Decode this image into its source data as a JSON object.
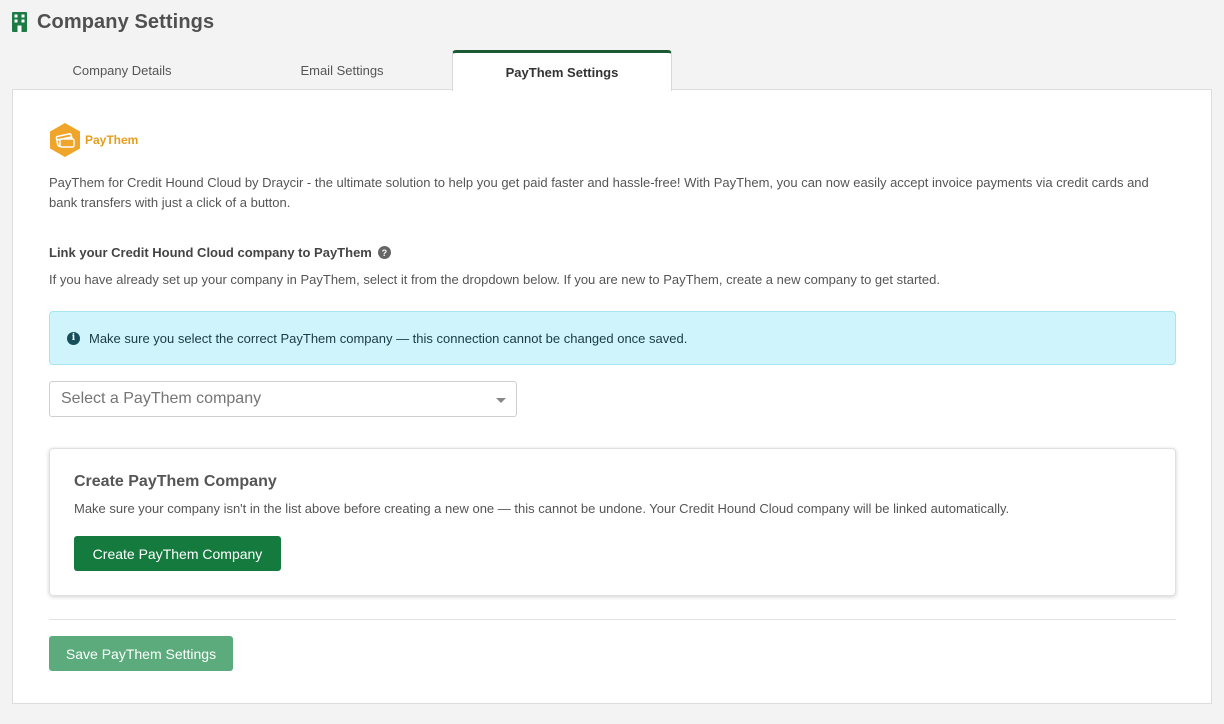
{
  "header": {
    "icon": "building-icon",
    "title": "Company Settings",
    "accent_color": "#1c5a34"
  },
  "tabs": [
    {
      "label": "Company Details",
      "active": false
    },
    {
      "label": "Email Settings",
      "active": false
    },
    {
      "label": "PayThem Settings",
      "active": true
    }
  ],
  "paythem": {
    "logo_text": "PayThem",
    "logo_color": "#e69e1f",
    "intro": "PayThem for Credit Hound Cloud by Draycir - the ultimate solution to help you get paid faster and hassle-free! With PayThem, you can now easily accept invoice payments via credit cards and bank transfers with just a click of a button.",
    "link_heading": "Link your Credit Hound Cloud company to PayThem",
    "help_icon_glyph": "?",
    "link_description": "If you have already set up your company in PayThem, select it from the dropdown below. If you are new to PayThem, create a new company to get started.",
    "alert": {
      "icon_glyph": "i",
      "text": "Make sure you select the correct PayThem company — this connection cannot be changed once saved.",
      "background": "#cff4fc"
    },
    "select": {
      "placeholder": "Select a PayThem company",
      "value": ""
    },
    "create_card": {
      "title": "Create PayThem Company",
      "description": "Make sure your company isn't in the list above before creating a new one — this cannot be undone. Your Credit Hound Cloud company will be linked automatically.",
      "button_label": "Create PayThem Company",
      "button_color": "#157a3d"
    },
    "save_button": {
      "label": "Save PayThem Settings",
      "color": "#5cab7c"
    }
  }
}
